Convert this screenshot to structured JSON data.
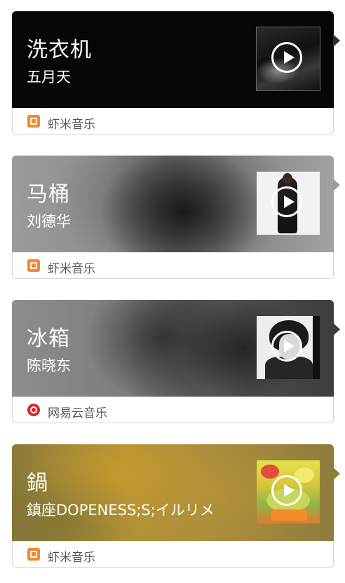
{
  "cards": [
    {
      "title": "洗衣机",
      "artist": "五月天",
      "source": "虾米音乐",
      "source_icon": "xiami-music-icon"
    },
    {
      "title": "马桶",
      "artist": "刘德华",
      "source": "虾米音乐",
      "source_icon": "xiami-music-icon"
    },
    {
      "title": "冰箱",
      "artist": "陈晓东",
      "source": "网易云音乐",
      "source_icon": "netease-cloud-music-icon"
    },
    {
      "title": "鍋",
      "artist": "鎮座DOPENESS;S;イルリメ",
      "source": "虾米音乐",
      "source_icon": "xiami-music-icon"
    }
  ],
  "colors": {
    "xiami": "#f28a2e",
    "netease": "#d6292b",
    "source_text": "#555555"
  }
}
